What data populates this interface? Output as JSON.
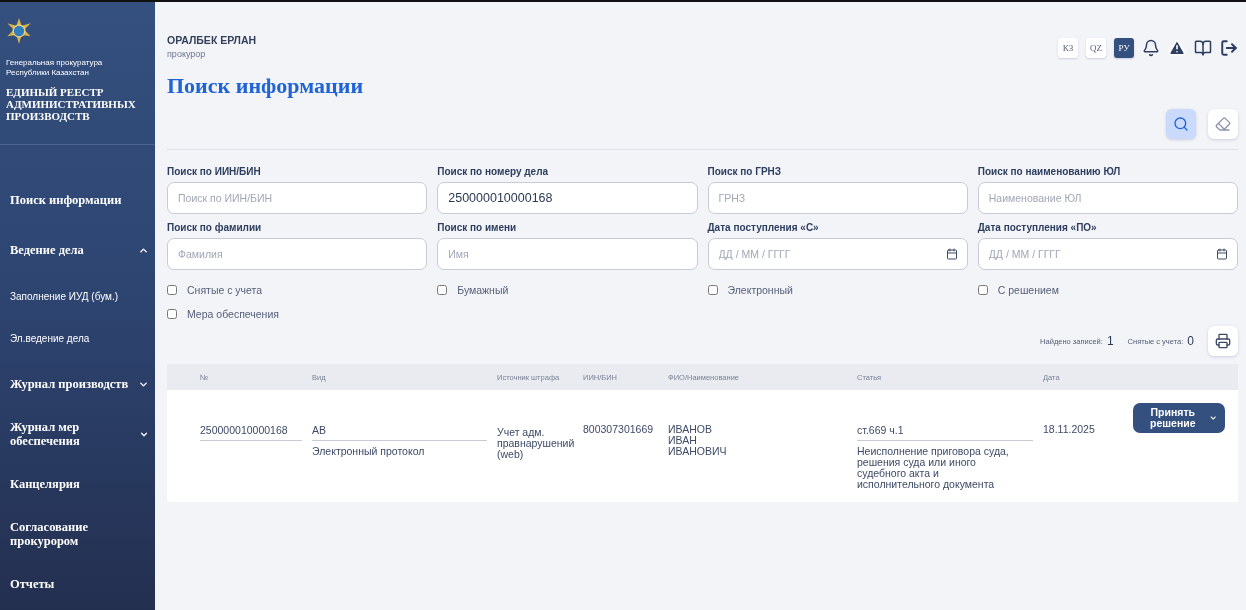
{
  "sidebar": {
    "org": "Генеральная прокуратура Республики Казахстан",
    "system": "ЕДИНЫЙ РЕЕСТР АДМИНИСТРАТИВНЫХ ПРОИЗВОДСТВ",
    "items": [
      {
        "kind": "link",
        "label": "Поиск информации"
      },
      {
        "kind": "group",
        "label": "Ведение дела",
        "expanded": true,
        "children": [
          {
            "label": "Заполнение ИУД (бум.)"
          },
          {
            "label": "Эл.ведение дела"
          }
        ]
      },
      {
        "kind": "group",
        "label": "Журнал производств",
        "expanded": false
      },
      {
        "kind": "group",
        "label": "Журнал мер обеспечения",
        "expanded": false
      },
      {
        "kind": "link",
        "label": "Канцелярия"
      },
      {
        "kind": "link",
        "label": "Согласование прокурором"
      },
      {
        "kind": "link",
        "label": "Отчеты"
      }
    ]
  },
  "user": {
    "name": "ОРАЛБЕК ЕРЛАН",
    "role": "прокурор"
  },
  "languages": [
    {
      "label": "КЗ",
      "selected": false
    },
    {
      "label": "QZ",
      "selected": false
    },
    {
      "label": "РУ",
      "selected": true
    }
  ],
  "title": "Поиск информации",
  "fields": [
    {
      "label": "Поиск по ИИН/БИН",
      "placeholder": "Поиск по ИИН/БИН",
      "kind": "text"
    },
    {
      "label": "Поиск по номеру дела",
      "value": "250000010000168",
      "kind": "text"
    },
    {
      "label": "Поиск по ГРНЗ",
      "placeholder": "ГРНЗ",
      "kind": "text"
    },
    {
      "label": "Поиск по наименованию ЮЛ",
      "placeholder": "Наименование ЮЛ",
      "kind": "text"
    },
    {
      "label": "Поиск по фамилии",
      "placeholder": "Фамилия",
      "kind": "text"
    },
    {
      "label": "Поиск по имени",
      "placeholder": "Имя",
      "kind": "text"
    },
    {
      "label": "Дата поступления «С»",
      "placeholder": "ДД / ММ / ГГГГ",
      "kind": "date"
    },
    {
      "label": "Дата поступления «ПО»",
      "placeholder": "ДД / ММ / ГГГГ",
      "kind": "date"
    }
  ],
  "checkboxes": [
    {
      "label": "Снятые с учета",
      "checked": false
    },
    {
      "label": "Бумажный",
      "checked": false
    },
    {
      "label": "Электронный",
      "checked": false
    },
    {
      "label": "С решением",
      "checked": false
    },
    {
      "label": "Мера обеспечения",
      "checked": false
    }
  ],
  "counts": [
    {
      "label": "Найдено записей:",
      "value": "1"
    },
    {
      "label": "Снятые с учета:",
      "value": "0"
    }
  ],
  "table": {
    "columns": [
      "№",
      "Вид",
      "Источник штрафа",
      "ИИН/БИН",
      "ФИО/Наименование",
      "Статья",
      "Дата"
    ],
    "rows": [
      {
        "number": "250000010000168",
        "type_code": "АВ",
        "type_name": "Электронный протокол",
        "source": "Учет адм. правнарушений (web)",
        "iin": "800307301669",
        "name": "ИВАНОВ ИВАН ИВАНОВИЧ",
        "article_code": "ст.669 ч.1",
        "article_text": "Неисполнение приговора суда, решения суда или иного судебного акта и исполнительного документа",
        "date": "18.11.2025",
        "action": "Принять решение"
      }
    ]
  }
}
